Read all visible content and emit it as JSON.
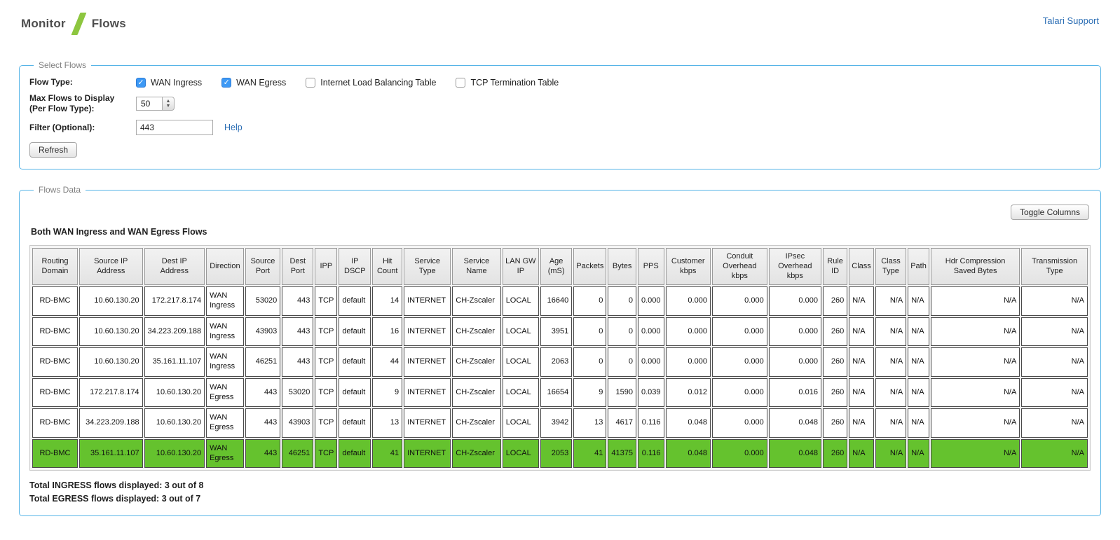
{
  "header": {
    "breadcrumb_left": "Monitor",
    "breadcrumb_right": "Flows",
    "support_link": "Talari Support"
  },
  "select_flows": {
    "legend": "Select Flows",
    "flow_type_label": "Flow Type:",
    "flow_type_options": [
      {
        "label": "WAN Ingress",
        "checked": true
      },
      {
        "label": "WAN Egress",
        "checked": true
      },
      {
        "label": "Internet Load Balancing Table",
        "checked": false
      },
      {
        "label": "TCP Termination Table",
        "checked": false
      }
    ],
    "max_flows_label_line1": "Max Flows to Display",
    "max_flows_label_line2": "(Per Flow Type):",
    "max_flows_value": "50",
    "filter_label": "Filter (Optional):",
    "filter_value": "443",
    "help_link": "Help",
    "refresh_button": "Refresh"
  },
  "flows_data": {
    "legend": "Flows Data",
    "toggle_columns_button": "Toggle Columns",
    "table_title": "Both WAN Ingress and WAN Egress Flows",
    "table": {
      "columns": [
        {
          "label": "Routing Domain",
          "align": "center"
        },
        {
          "label": "Source IP Address",
          "align": "right"
        },
        {
          "label": "Dest IP Address",
          "align": "right"
        },
        {
          "label": "Direction",
          "align": "left"
        },
        {
          "label": "Source Port",
          "align": "right"
        },
        {
          "label": "Dest Port",
          "align": "right"
        },
        {
          "label": "IPP",
          "align": "center"
        },
        {
          "label": "IP DSCP",
          "align": "left"
        },
        {
          "label": "Hit Count",
          "align": "right"
        },
        {
          "label": "Service Type",
          "align": "left"
        },
        {
          "label": "Service Name",
          "align": "left"
        },
        {
          "label": "LAN GW IP",
          "align": "left"
        },
        {
          "label": "Age (mS)",
          "align": "right"
        },
        {
          "label": "Packets",
          "align": "right"
        },
        {
          "label": "Bytes",
          "align": "right"
        },
        {
          "label": "PPS",
          "align": "right"
        },
        {
          "label": "Customer kbps",
          "align": "right"
        },
        {
          "label": "Conduit Overhead kbps",
          "align": "right"
        },
        {
          "label": "IPsec Overhead kbps",
          "align": "right"
        },
        {
          "label": "Rule ID",
          "align": "right"
        },
        {
          "label": "Class",
          "align": "left"
        },
        {
          "label": "Class Type",
          "align": "right"
        },
        {
          "label": "Path",
          "align": "left"
        },
        {
          "label": "Hdr Compression Saved Bytes",
          "align": "right"
        },
        {
          "label": "Transmission Type",
          "align": "right"
        }
      ],
      "rows": [
        {
          "highlight": false,
          "cells": [
            "RD-BMC",
            "10.60.130.20",
            "172.217.8.174",
            "WAN Ingress",
            "53020",
            "443",
            "TCP",
            "default",
            "14",
            "INTERNET",
            "CH-Zscaler",
            "LOCAL",
            "16640",
            "0",
            "0",
            "0.000",
            "0.000",
            "0.000",
            "0.000",
            "260",
            "N/A",
            "N/A",
            "N/A",
            "N/A",
            "N/A"
          ]
        },
        {
          "highlight": false,
          "cells": [
            "RD-BMC",
            "10.60.130.20",
            "34.223.209.188",
            "WAN Ingress",
            "43903",
            "443",
            "TCP",
            "default",
            "16",
            "INTERNET",
            "CH-Zscaler",
            "LOCAL",
            "3951",
            "0",
            "0",
            "0.000",
            "0.000",
            "0.000",
            "0.000",
            "260",
            "N/A",
            "N/A",
            "N/A",
            "N/A",
            "N/A"
          ]
        },
        {
          "highlight": false,
          "cells": [
            "RD-BMC",
            "10.60.130.20",
            "35.161.11.107",
            "WAN Ingress",
            "46251",
            "443",
            "TCP",
            "default",
            "44",
            "INTERNET",
            "CH-Zscaler",
            "LOCAL",
            "2063",
            "0",
            "0",
            "0.000",
            "0.000",
            "0.000",
            "0.000",
            "260",
            "N/A",
            "N/A",
            "N/A",
            "N/A",
            "N/A"
          ]
        },
        {
          "highlight": false,
          "cells": [
            "RD-BMC",
            "172.217.8.174",
            "10.60.130.20",
            "WAN Egress",
            "443",
            "53020",
            "TCP",
            "default",
            "9",
            "INTERNET",
            "CH-Zscaler",
            "LOCAL",
            "16654",
            "9",
            "1590",
            "0.039",
            "0.012",
            "0.000",
            "0.016",
            "260",
            "N/A",
            "N/A",
            "N/A",
            "N/A",
            "N/A"
          ]
        },
        {
          "highlight": false,
          "cells": [
            "RD-BMC",
            "34.223.209.188",
            "10.60.130.20",
            "WAN Egress",
            "443",
            "43903",
            "TCP",
            "default",
            "13",
            "INTERNET",
            "CH-Zscaler",
            "LOCAL",
            "3942",
            "13",
            "4617",
            "0.116",
            "0.048",
            "0.000",
            "0.048",
            "260",
            "N/A",
            "N/A",
            "N/A",
            "N/A",
            "N/A"
          ]
        },
        {
          "highlight": true,
          "cells": [
            "RD-BMC",
            "35.161.11.107",
            "10.60.130.20",
            "WAN Egress",
            "443",
            "46251",
            "TCP",
            "default",
            "41",
            "INTERNET",
            "CH-Zscaler",
            "LOCAL",
            "2053",
            "41",
            "41375",
            "0.116",
            "0.048",
            "0.000",
            "0.048",
            "260",
            "N/A",
            "N/A",
            "N/A",
            "N/A",
            "N/A"
          ]
        }
      ]
    },
    "totals": [
      "Total INGRESS flows displayed: 3 out of 8",
      "Total EGRESS flows displayed: 3 out of 7"
    ]
  },
  "colors": {
    "accent_green": "#8dc63f",
    "highlight_row_green": "#65c22e",
    "fieldset_border_blue": "#56b4e7",
    "link_blue": "#2a6db4"
  }
}
